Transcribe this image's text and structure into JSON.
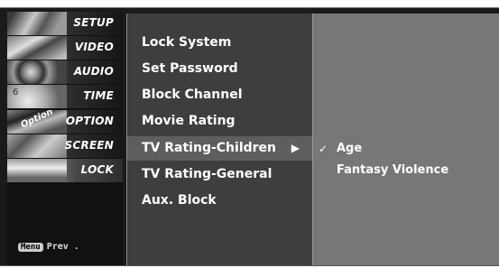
{
  "tabs": [
    {
      "label": "SETUP",
      "icon": "setup-thumbnail-icon"
    },
    {
      "label": "VIDEO",
      "icon": "video-thumbnail-icon"
    },
    {
      "label": "AUDIO",
      "icon": "audio-thumbnail-icon"
    },
    {
      "label": "TIME",
      "icon": "time-thumbnail-icon"
    },
    {
      "label": "OPTION",
      "icon": "option-thumbnail-icon"
    },
    {
      "label": "SCREEN",
      "icon": "screen-thumbnail-icon"
    },
    {
      "label": "LOCK",
      "icon": "lock-thumbnail-icon"
    }
  ],
  "thumb_text": {
    "option": "Option",
    "time": "6"
  },
  "footer": {
    "key": "Menu",
    "label": "Prev ."
  },
  "menu": {
    "items": [
      {
        "label": "Lock System"
      },
      {
        "label": "Set Password"
      },
      {
        "label": "Block Channel"
      },
      {
        "label": "Movie Rating"
      },
      {
        "label": "TV Rating-Children",
        "selected": true,
        "arrow": "▶"
      },
      {
        "label": "TV Rating-General"
      },
      {
        "label": "Aux. Block"
      }
    ]
  },
  "submenu": {
    "items": [
      {
        "label": "Age",
        "checked": true,
        "check": "✓"
      },
      {
        "label": "Fantasy Violence",
        "checked": false
      }
    ]
  },
  "colors": {
    "panel": "#3e3e3e",
    "highlight": "#5e5e5e",
    "submenu": "#777777"
  }
}
